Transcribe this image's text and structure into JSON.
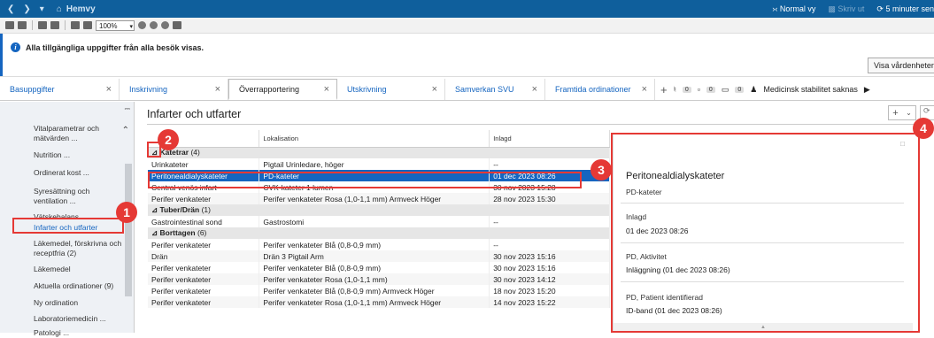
{
  "titlebar": {
    "home_label": "Hemvy",
    "view_mode": "Normal vy",
    "dim_label": "Skriv ut",
    "refresh_label": "5 minuter sen"
  },
  "toolbar": {
    "zoom": "100%"
  },
  "info": {
    "message": "Alla tillgängliga uppgifter från alla besök visas.",
    "visa_button": "Visa vårdenheter"
  },
  "tabs": [
    {
      "label": "Basuppgifter",
      "active": false
    },
    {
      "label": "Inskrivning",
      "active": false
    },
    {
      "label": "Överrapportering",
      "active": true
    },
    {
      "label": "Utskrivning",
      "active": false
    },
    {
      "label": "Samverkan SVU",
      "active": false
    },
    {
      "label": "Framtida ordinationer",
      "active": false
    }
  ],
  "tab_badges": [
    "0",
    "0",
    "0"
  ],
  "tab_extra_label": "Medicinsk stabilitet saknas",
  "sidebar": {
    "items": [
      "Vitalparametrar och mätvärden ...",
      "Nutrition ...",
      "Ordinerat kost ...",
      "Syresättning och ventilation ...",
      "Vätskebalans",
      "Infarter och utfarter",
      "Läkemedel, förskrivna och receptfria (2)",
      "Läkemedel",
      "Aktuella ordinationer (9)",
      "Ny ordination",
      "Laboratoriemedicin ...",
      "Patologi ..."
    ]
  },
  "main": {
    "title": "Infarter och utfarter",
    "columns": [
      "",
      "Lokalisation",
      "Inlagd"
    ],
    "groups": [
      {
        "name": "Katetrar",
        "count": "(4)",
        "rows": [
          {
            "c1": "Urinkateter",
            "c2": "Pigtail Urinledare, höger",
            "c3": "--"
          },
          {
            "c1": "Peritonealdialyskateter",
            "c2": "PD-kateter",
            "c3": "01 dec 2023 08:26"
          },
          {
            "c1": "Central venös infart",
            "c2": "CVK-kateter 1 lumen",
            "c3": "30 nov 2023 15:28"
          },
          {
            "c1": "Perifer venkateter",
            "c2": "Perifer venkateter Rosa (1,0-1,1 mm) Armveck Höger",
            "c3": "28 nov 2023 15:30"
          }
        ]
      },
      {
        "name": "Tuber/Drän",
        "count": "(1)",
        "rows": [
          {
            "c1": "Gastrointestinal sond",
            "c2": "Gastrostomi",
            "c3": "--"
          }
        ]
      },
      {
        "name": "Borttagen",
        "count": "(6)",
        "rows": [
          {
            "c1": "Perifer venkateter",
            "c2": "Perifer venkateter Blå (0,8-0,9 mm)",
            "c3": "--"
          },
          {
            "c1": "Drän",
            "c2": "Drän 3 Pigtail Arm",
            "c3": "30 nov 2023 15:16"
          },
          {
            "c1": "Perifer venkateter",
            "c2": "Perifer venkateter Blå (0,8-0,9 mm)",
            "c3": "30 nov 2023 15:16"
          },
          {
            "c1": "Perifer venkateter",
            "c2": "Perifer venkateter Rosa (1,0-1,1 mm)",
            "c3": "30 nov 2023 14:12"
          },
          {
            "c1": "Perifer venkateter",
            "c2": "Perifer venkateter Blå (0,8-0,9 mm) Armveck Höger",
            "c3": "18 nov 2023 15:20"
          },
          {
            "c1": "Perifer venkateter",
            "c2": "Perifer venkateter Rosa (1,0-1,1 mm) Armveck Höger",
            "c3": "14 nov 2023 15:22"
          }
        ]
      }
    ]
  },
  "detail": {
    "title": "Peritonealdialyskateter",
    "subtitle": "PD-kateter",
    "inlagd_label": "Inlagd",
    "inlagd_value": "01 dec 2023 08:26",
    "aktivitet_label": "PD, Aktivitet",
    "aktivitet_value": "Inläggning (01 dec 2023 08:26)",
    "patient_label": "PD, Patient identifierad",
    "patient_value": "ID-band (01 dec 2023 08:26)"
  },
  "markers": [
    "1",
    "2",
    "3",
    "4"
  ],
  "colors": {
    "accent": "#1565c0",
    "titlebar": "#0f5f9c",
    "highlight": "#e53935"
  }
}
